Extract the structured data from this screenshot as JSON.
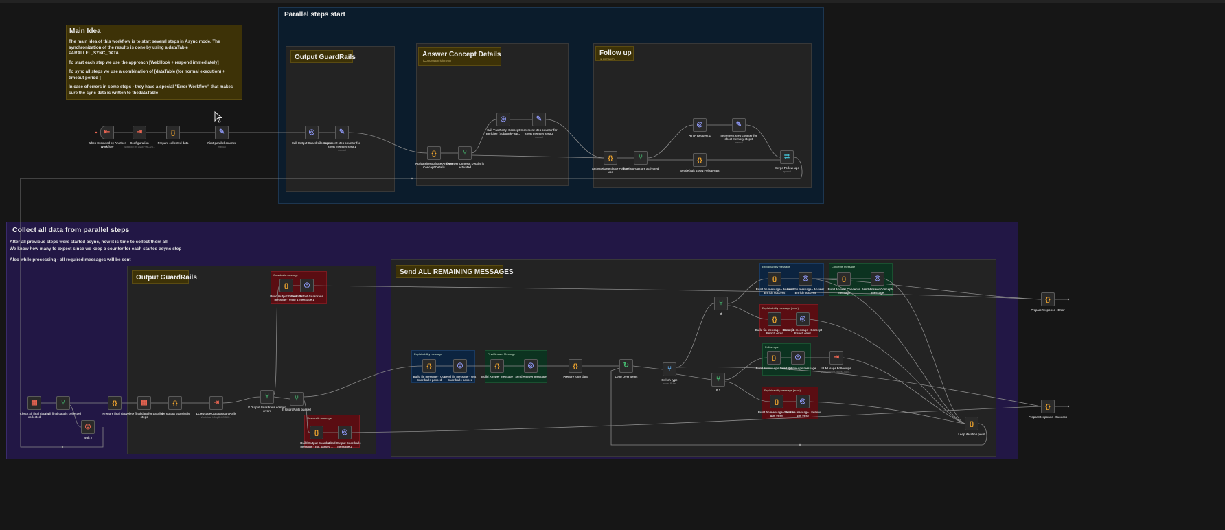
{
  "groups": {
    "parallel": {
      "title": "Parallel steps start"
    },
    "collect": {
      "title": "Collect all data from parallel steps",
      "desc": [
        "After all previous steps were started async, now it is time to collect them all",
        "We know how many to expect since we keep a counter for each started async step",
        "",
        "Also while processing - all required messages will be sent"
      ]
    },
    "out_guard_top": {
      "title": "Output GuardRails"
    },
    "answer_concept": {
      "title": "Answer Concept Details",
      "sub": "(Concept Enrichment)"
    },
    "follow_up": {
      "title": "Follow up",
      "sub": "automation"
    },
    "out_guard_bottom": {
      "title": "Output GuardRails"
    },
    "send_all": {
      "title": "Send ALL REMAINING MESSAGES"
    }
  },
  "main_idea": {
    "title": "Main Idea",
    "paragraphs": [
      "The main idea of this workflow is to start several steps in Async mode. The synchronization of the results is done by using a dataTable PARALLEL_SYNC_DATA.",
      "To start each step we use the approach [WebHook + respond immediately]",
      "To sync all steps we use a combination of [dataTable (for normal execution) + timeout period ]",
      "In case of errors in some steps - they have a special \"Error Workflow\" that makes sure the sync data is written to thedataTable"
    ]
  },
  "stickies": {
    "guard_msg_1": "Guardrails message",
    "guard_msg_2": "Guardrails message",
    "expl_msg_1": "Explainability message",
    "final_answer": "Final Answer Message",
    "expl_msg_2": "Explainability message",
    "concepts_msg": "Concepts message",
    "expl_error_1": "Explainability message (error)",
    "followups_msg": "Follow-ups",
    "expl_error_2": "Explainability message (error)"
  },
  "icons": {
    "code": "{}",
    "http": "globe-icon",
    "set": "pencil-icon",
    "if": "signpost-icon",
    "exec": "arrow-into-box-icon",
    "table": "grid-icon",
    "wait": "pause-icon",
    "merge": "merge-icon",
    "loop": "loop-icon",
    "switch": "switch-icon"
  },
  "nodes": [
    {
      "id": "trigger",
      "type": "trig",
      "label": "When Executed by Another Workflow",
      "sub": ""
    },
    {
      "id": "configuration",
      "type": "exec",
      "label": "Configuration",
      "sub": "Workflow: lf_LoAEFfatCVB..."
    },
    {
      "id": "prepare_collected",
      "type": "code",
      "label": "Prepare collected data",
      "sub": ""
    },
    {
      "id": "first_counter",
      "type": "set",
      "label": "First parallel counter",
      "sub": "manual"
    },
    {
      "id": "call_guardrails",
      "type": "http",
      "label": "Call Output Guardrails Async",
      "sub": ""
    },
    {
      "id": "inc_counter_1",
      "type": "set",
      "label": "Increment step counter for short memory step 1",
      "sub": "manual"
    },
    {
      "id": "activate_concept",
      "type": "code",
      "label": "Activate/Deactivate Answer Concept Details",
      "sub": ""
    },
    {
      "id": "if_concept",
      "type": "if",
      "label": "If Answer Concept Details is activated",
      "sub": ""
    },
    {
      "id": "call_fastparty",
      "type": "http",
      "label": "Call 'FastParty' Concept Enricher (SubworkFlow...",
      "sub": ""
    },
    {
      "id": "inc_counter_2",
      "type": "set",
      "label": "Increment step counter for short memory step 2",
      "sub": "manual"
    },
    {
      "id": "activate_followups",
      "type": "code",
      "label": "Activate/Deactivate Follow-ups",
      "sub": ""
    },
    {
      "id": "if_followups",
      "type": "if",
      "label": "If Follow-ups are activated",
      "sub": ""
    },
    {
      "id": "http_request_1",
      "type": "http",
      "label": "HTTP Request 1",
      "sub": ""
    },
    {
      "id": "inc_counter_3",
      "type": "set",
      "label": "Increment step counter for short memory step 3",
      "sub": "manual"
    },
    {
      "id": "set_default_json",
      "type": "code",
      "label": "Set default JSON Follow-ups",
      "sub": ""
    },
    {
      "id": "merge_followups",
      "type": "merge",
      "label": "Merge Follow-ups",
      "sub": "append"
    },
    {
      "id": "check_final",
      "type": "table",
      "label": "Check all final data is collected",
      "sub": ""
    },
    {
      "id": "if_final_collected",
      "type": "if",
      "label": "If all final data is collected",
      "sub": ""
    },
    {
      "id": "wait_2",
      "type": "wait",
      "label": "Wait 2",
      "sub": ""
    },
    {
      "id": "prepare_final",
      "type": "code",
      "label": "Prepare final data",
      "sub": ""
    },
    {
      "id": "delete_final",
      "type": "table",
      "label": "Delete final data for parallel steps",
      "sub": ""
    },
    {
      "id": "get_output_guardrails",
      "type": "code",
      "label": "Get output guardrails",
      "sub": ""
    },
    {
      "id": "llm_usage_guard",
      "type": "exec",
      "label": "LLMUsage OutputGuardRails",
      "sub": "Workflow: b8Jq4DKOSRX..."
    },
    {
      "id": "if_output_guard_errors",
      "type": "if",
      "label": "If Output Guardrails contain errors",
      "sub": ""
    },
    {
      "id": "if_guardrails_passed",
      "type": "if",
      "label": "If GuardRails passed",
      "sub": ""
    },
    {
      "id": "build_guard_error",
      "type": "code",
      "label": "Build Output Guardrails message - error 1",
      "sub": ""
    },
    {
      "id": "send_guard_1",
      "type": "http",
      "label": "Send Output Guardrails message 1",
      "sub": ""
    },
    {
      "id": "build_guard_notpassed",
      "type": "code",
      "label": "Build Output Guardrails message - not passed 1",
      "sub": ""
    },
    {
      "id": "send_guard_2",
      "type": "http",
      "label": "Send Output Guardrails message 2",
      "sub": ""
    },
    {
      "id": "build_fin_out_guard",
      "type": "code",
      "label": "Build fin message - Out Guardrails passed",
      "sub": ""
    },
    {
      "id": "send_fin_out_guard",
      "type": "http",
      "label": "Send fin message - Out Guardrails passed",
      "sub": ""
    },
    {
      "id": "build_answer",
      "type": "code",
      "label": "Build Answer message",
      "sub": ""
    },
    {
      "id": "send_answer",
      "type": "http",
      "label": "Send Answer message",
      "sub": ""
    },
    {
      "id": "prepare_loop",
      "type": "code",
      "label": "Prepare loop data",
      "sub": ""
    },
    {
      "id": "loop_over_items",
      "type": "loop",
      "label": "Loop Over Items",
      "sub": ""
    },
    {
      "id": "switch_type",
      "type": "switch",
      "label": "Switch type",
      "sub": "mode: Rules"
    },
    {
      "id": "if_a",
      "type": "if",
      "label": "If",
      "sub": ""
    },
    {
      "id": "if_b",
      "type": "if",
      "label": "If 1",
      "sub": ""
    },
    {
      "id": "build_fin_answer_enrich",
      "type": "code",
      "label": "Build fin message - Answer Enrich success",
      "sub": ""
    },
    {
      "id": "send_fin_answer_enrich",
      "type": "http",
      "label": "Send fin message - Answer Enrich success",
      "sub": ""
    },
    {
      "id": "build_answer_concepts",
      "type": "code",
      "label": "Build Answer Concepts message",
      "sub": ""
    },
    {
      "id": "send_answer_concepts",
      "type": "http",
      "label": "Send Answer Concepts message",
      "sub": ""
    },
    {
      "id": "build_concept_error",
      "type": "code",
      "label": "Build fin message - Concept Enrich error",
      "sub": ""
    },
    {
      "id": "send_concept_error",
      "type": "http",
      "label": "Send fin message - Concept Enrich error",
      "sub": ""
    },
    {
      "id": "build_followups",
      "type": "code",
      "label": "Build Follow-ups message",
      "sub": ""
    },
    {
      "id": "send_followups",
      "type": "http",
      "label": "Send Follow-ups message",
      "sub": ""
    },
    {
      "id": "llm_usage_followups",
      "type": "exec",
      "label": "LLMUsage Followups",
      "sub": "Workflow: b8Jq4DKOSRX..."
    },
    {
      "id": "build_followups_error",
      "type": "code",
      "label": "Build fin message - Follow-ups error",
      "sub": ""
    },
    {
      "id": "send_followups_error",
      "type": "http",
      "label": "Send fin message - Follow-ups error",
      "sub": ""
    },
    {
      "id": "loop_iteration",
      "type": "code",
      "label": "Loop iteration point",
      "sub": ""
    },
    {
      "id": "prepare_response_error",
      "type": "code",
      "label": "PrepareResponse - Error",
      "sub": ""
    },
    {
      "id": "prepare_response_success",
      "type": "code",
      "label": "PrepareResponse - Success",
      "sub": ""
    }
  ]
}
